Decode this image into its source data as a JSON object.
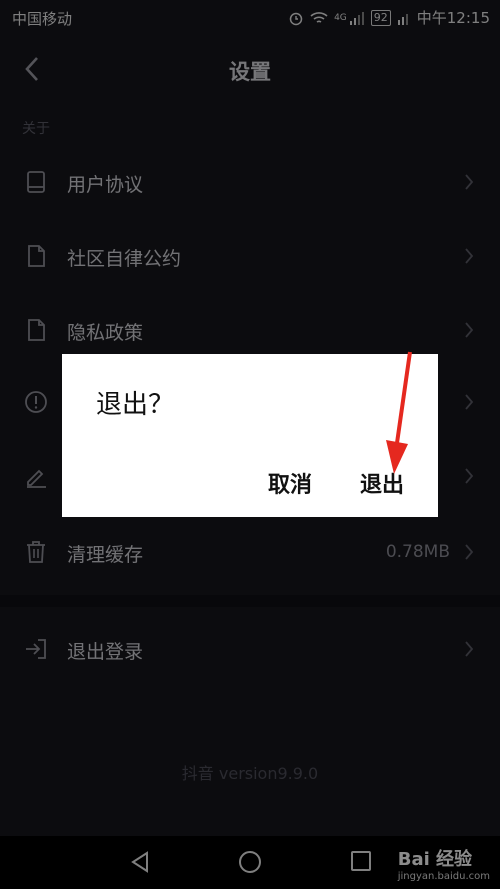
{
  "status_bar": {
    "carrier": "中国移动",
    "net": "4G",
    "battery": "92",
    "time": "中午12:15"
  },
  "header": {
    "title": "设置"
  },
  "section_about": "关于",
  "items": [
    {
      "label": "用户协议",
      "icon": "book-icon"
    },
    {
      "label": "社区自律公约",
      "icon": "document-icon"
    },
    {
      "label": "隐私政策",
      "icon": "document-icon"
    },
    {
      "label": "",
      "icon": "alert-circle-icon"
    },
    {
      "label": "",
      "icon": "edit-icon"
    },
    {
      "label": "清理缓存",
      "icon": "trash-icon",
      "value": "0.78MB"
    }
  ],
  "logout": {
    "label": "退出登录",
    "icon": "logout-icon"
  },
  "version": "抖音 version9.9.0",
  "dialog": {
    "question": "退出？",
    "cancel": "取消",
    "confirm": "退出"
  },
  "watermark": {
    "brand": "Bai 经验",
    "url": "jingyan.baidu.com"
  },
  "colors": {
    "background": "#16161c",
    "dialog": "#ffffff",
    "annotation_arrow": "#e5281f"
  }
}
